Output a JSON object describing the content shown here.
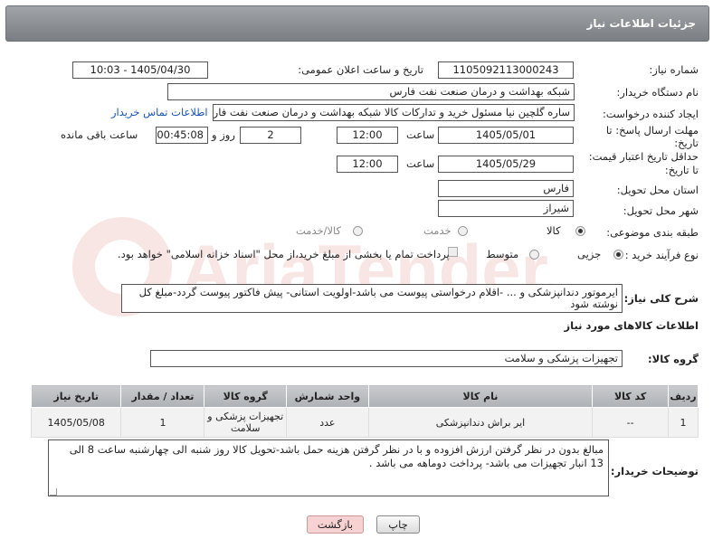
{
  "header": {
    "title": "جزئیات اطلاعات نیاز"
  },
  "need_number": {
    "label": "شماره نیاز:",
    "value": "1105092113000243"
  },
  "announce": {
    "label": "تاریخ و ساعت اعلان عمومی:",
    "value": "1405/04/30 - 10:03"
  },
  "buyer_org": {
    "label": "نام دستگاه خریدار:",
    "value": "شبکه بهداشت و درمان صنعت نفت فارس"
  },
  "requester": {
    "label": "ایجاد کننده درخواست:",
    "value": "ساره گلچین نیا مسئول خرید و تدارکات کالا شبکه بهداشت و درمان صنعت نفت فارس",
    "contact_link": "اطلاعات تماس خریدار"
  },
  "deadline": {
    "label_line1": "مهلت ارسال پاسخ: تا",
    "label_line2": "تاریخ:",
    "date": "1405/05/01",
    "time_label": "ساعت",
    "time": "12:00",
    "days": "2",
    "days_label": "روز و",
    "remaining": "00:45:08",
    "remaining_label": "ساعت باقی مانده"
  },
  "price_validity": {
    "label_line1": "حداقل تاریخ اعتبار قیمت:",
    "label_line2": "تا تاریخ:",
    "date": "1405/05/29",
    "time_label": "ساعت",
    "time": "12:00"
  },
  "province": {
    "label": "استان محل تحویل:",
    "value": "فارس"
  },
  "city": {
    "label": "شهر محل تحویل:",
    "value": "شیراز"
  },
  "category": {
    "label": "طبقه بندی موضوعی:",
    "options": [
      "کالا",
      "خدمت",
      "کالا/خدمت"
    ],
    "selected": "کالا"
  },
  "purchase_process": {
    "label": "نوع فرآیند خرید :",
    "options": [
      "جزیی",
      "متوسط"
    ],
    "selected": "جزیی",
    "checkbox_text": "پرداخت تمام یا بخشی از مبلغ خرید،از محل \"اسناد خزانه اسلامی\" خواهد بود."
  },
  "description": {
    "label": "شرح کلی نیاز:",
    "value": "ایرموتور دندانپزشکی و ... -اقلام درخواستی پیوست می باشد-اولویت استانی- پیش فاکتور پیوست گردد-مبلغ کل نوشته شود"
  },
  "goods_info": {
    "title": "اطلاعات کالاهای مورد نیاز"
  },
  "goods_group": {
    "label": "گروه کالا:",
    "value": "تجهیزات پزشکی و سلامت"
  },
  "table": {
    "headers": [
      "ردیف",
      "کد کالا",
      "نام کالا",
      "واحد شمارش",
      "گروه کالا",
      "تعداد / مقدار",
      "تاریخ نیاز"
    ],
    "rows": [
      {
        "row": "1",
        "code": "--",
        "name": "ایر براش دندانپزشکی",
        "unit": "عدد",
        "group": "تجهیزات پزشکی و سلامت",
        "qty": "1",
        "date": "1405/05/08"
      }
    ]
  },
  "buyer_notes": {
    "label": "توضیحات خریدار:",
    "value": "مبالغ بدون در نظر گرفتن ارزش افزوده و با در نظر گرفتن هزینه حمل باشد-تحویل کالا روز شنبه الی چهارشنبه ساعت 8 الی 13 انبار تجهیزات می باشد- پرداخت دوماهه می باشد ."
  },
  "buttons": {
    "print": "چاپ",
    "back": "بازگشت"
  },
  "watermark": {
    "text": "AriaTender.net"
  }
}
